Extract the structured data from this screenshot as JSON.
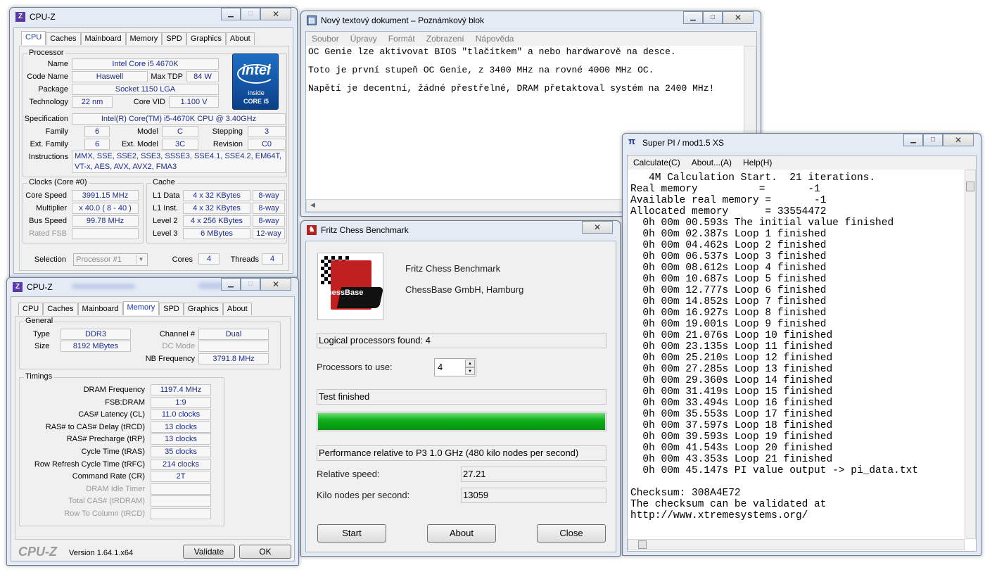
{
  "cpuz1": {
    "title": "CPU-Z",
    "tabs": [
      "CPU",
      "Caches",
      "Mainboard",
      "Memory",
      "SPD",
      "Graphics",
      "About"
    ],
    "processor_group": "Processor",
    "name_label": "Name",
    "name": "Intel Core i5 4670K",
    "codename_label": "Code Name",
    "codename": "Haswell",
    "maxtdp_label": "Max TDP",
    "maxtdp": "84 W",
    "package_label": "Package",
    "package": "Socket 1150 LGA",
    "technology_label": "Technology",
    "technology": "22 nm",
    "corevid_label": "Core VID",
    "corevid": "1.100 V",
    "spec_label": "Specification",
    "spec": "Intel(R) Core(TM) i5-4670K CPU @ 3.40GHz",
    "family_label": "Family",
    "family": "6",
    "model_label": "Model",
    "model": "C",
    "stepping_label": "Stepping",
    "stepping": "3",
    "extfamily_label": "Ext. Family",
    "extfamily": "6",
    "extmodel_label": "Ext. Model",
    "extmodel": "3C",
    "revision_label": "Revision",
    "revision": "C0",
    "instr_label": "Instructions",
    "instr": "MMX, SSE, SSE2, SSE3, SSSE3, SSE4.1, SSE4.2, EM64T, VT-x, AES, AVX, AVX2, FMA3",
    "intel_logo": {
      "brand": "intel",
      "line1": "inside",
      "line2": "CORE i5"
    },
    "clocks_group": "Clocks (Core #0)",
    "corespeed_label": "Core Speed",
    "corespeed": "3991.15 MHz",
    "multiplier_label": "Multiplier",
    "multiplier": "x 40.0 ( 8 - 40 )",
    "busspeed_label": "Bus Speed",
    "busspeed": "99.78 MHz",
    "ratedfsb_label": "Rated FSB",
    "cache_group": "Cache",
    "l1d_label": "L1 Data",
    "l1d": "4 x 32 KBytes",
    "l1d_way": "8-way",
    "l1i_label": "L1 Inst.",
    "l1i": "4 x 32 KBytes",
    "l1i_way": "8-way",
    "l2_label": "Level 2",
    "l2": "4 x 256 KBytes",
    "l2_way": "8-way",
    "l3_label": "Level 3",
    "l3": "6 MBytes",
    "l3_way": "12-way",
    "selection_label": "Selection",
    "selection": "Processor #1",
    "cores_label": "Cores",
    "cores": "4",
    "threads_label": "Threads",
    "threads": "4"
  },
  "cpuz2": {
    "title": "CPU-Z",
    "tabs": [
      "CPU",
      "Caches",
      "Mainboard",
      "Memory",
      "SPD",
      "Graphics",
      "About"
    ],
    "general_group": "General",
    "type_label": "Type",
    "type": "DDR3",
    "size_label": "Size",
    "size": "8192 MBytes",
    "channel_label": "Channel #",
    "channel": "Dual",
    "dcmode_label": "DC Mode",
    "nbfreq_label": "NB Frequency",
    "nbfreq": "3791.8 MHz",
    "timings_group": "Timings",
    "timings": [
      {
        "label": "DRAM Frequency",
        "value": "1197.4 MHz",
        "dim": false
      },
      {
        "label": "FSB:DRAM",
        "value": "1:9",
        "dim": false
      },
      {
        "label": "CAS# Latency (CL)",
        "value": "11.0 clocks",
        "dim": false
      },
      {
        "label": "RAS# to CAS# Delay (tRCD)",
        "value": "13 clocks",
        "dim": false
      },
      {
        "label": "RAS# Precharge (tRP)",
        "value": "13 clocks",
        "dim": false
      },
      {
        "label": "Cycle Time (tRAS)",
        "value": "35 clocks",
        "dim": false
      },
      {
        "label": "Row Refresh Cycle Time (tRFC)",
        "value": "214 clocks",
        "dim": false
      },
      {
        "label": "Command Rate (CR)",
        "value": "2T",
        "dim": false
      },
      {
        "label": "DRAM Idle Timer",
        "value": "",
        "dim": true
      },
      {
        "label": "Total CAS# (tRDRAM)",
        "value": "",
        "dim": true
      },
      {
        "label": "Row To Column (tRCD)",
        "value": "",
        "dim": true
      }
    ],
    "brand": "CPU-Z",
    "version": "Version 1.64.1.x64",
    "validate": "Validate",
    "ok": "OK"
  },
  "notepad": {
    "title": "Nový textový dokument – Poznámkový blok",
    "menu": [
      "Soubor",
      "Úpravy",
      "Formát",
      "Zobrazení",
      "Nápověda"
    ],
    "lines": [
      "OC Genie lze aktivovat BIOS \"tlačítkem\" a nebo hardwarově na desce.",
      "Toto je první stupeň OC Genie, z 3400 MHz na rovné 4000 MHz OC.",
      "Napětí je decentní, žádné přestřelné, DRAM přetaktoval systém na 2400 MHz!"
    ]
  },
  "fritz": {
    "title": "Fritz Chess Benchmark",
    "logo_text": "ChessBase",
    "product": "Fritz Chess Benchmark",
    "company": "ChessBase GmbH, Hamburg",
    "logical": "Logical processors found: 4",
    "procs_label": "Processors to use:",
    "procs_value": "4",
    "status": "Test finished",
    "progress": 1.0,
    "perf_note": "Performance relative to P3 1.0 GHz (480 kilo nodes per second)",
    "relspeed_label": "Relative speed:",
    "relspeed": "27.21",
    "kns_label": "Kilo nodes per second:",
    "kns": "13059",
    "start": "Start",
    "about": "About",
    "close": "Close"
  },
  "superpi": {
    "title": "Super PI / mod1.5 XS",
    "menu": [
      "Calculate(C)",
      "About...(A)",
      "Help(H)"
    ],
    "output": "   4M Calculation Start.  21 iterations.\nReal memory          =       -1\nAvailable real memory =       -1\nAllocated memory      = 33554472\n  0h 00m 00.593s The initial value finished\n  0h 00m 02.387s Loop 1 finished\n  0h 00m 04.462s Loop 2 finished\n  0h 00m 06.537s Loop 3 finished\n  0h 00m 08.612s Loop 4 finished\n  0h 00m 10.687s Loop 5 finished\n  0h 00m 12.777s Loop 6 finished\n  0h 00m 14.852s Loop 7 finished\n  0h 00m 16.927s Loop 8 finished\n  0h 00m 19.001s Loop 9 finished\n  0h 00m 21.076s Loop 10 finished\n  0h 00m 23.135s Loop 11 finished\n  0h 00m 25.210s Loop 12 finished\n  0h 00m 27.285s Loop 13 finished\n  0h 00m 29.360s Loop 14 finished\n  0h 00m 31.419s Loop 15 finished\n  0h 00m 33.494s Loop 16 finished\n  0h 00m 35.553s Loop 17 finished\n  0h 00m 37.597s Loop 18 finished\n  0h 00m 39.593s Loop 19 finished\n  0h 00m 41.543s Loop 20 finished\n  0h 00m 43.353s Loop 21 finished\n  0h 00m 45.147s PI value output -> pi_data.txt\n\nChecksum: 308A4E72\nThe checksum can be validated at\nhttp://www.xtremesystems.org/"
  }
}
